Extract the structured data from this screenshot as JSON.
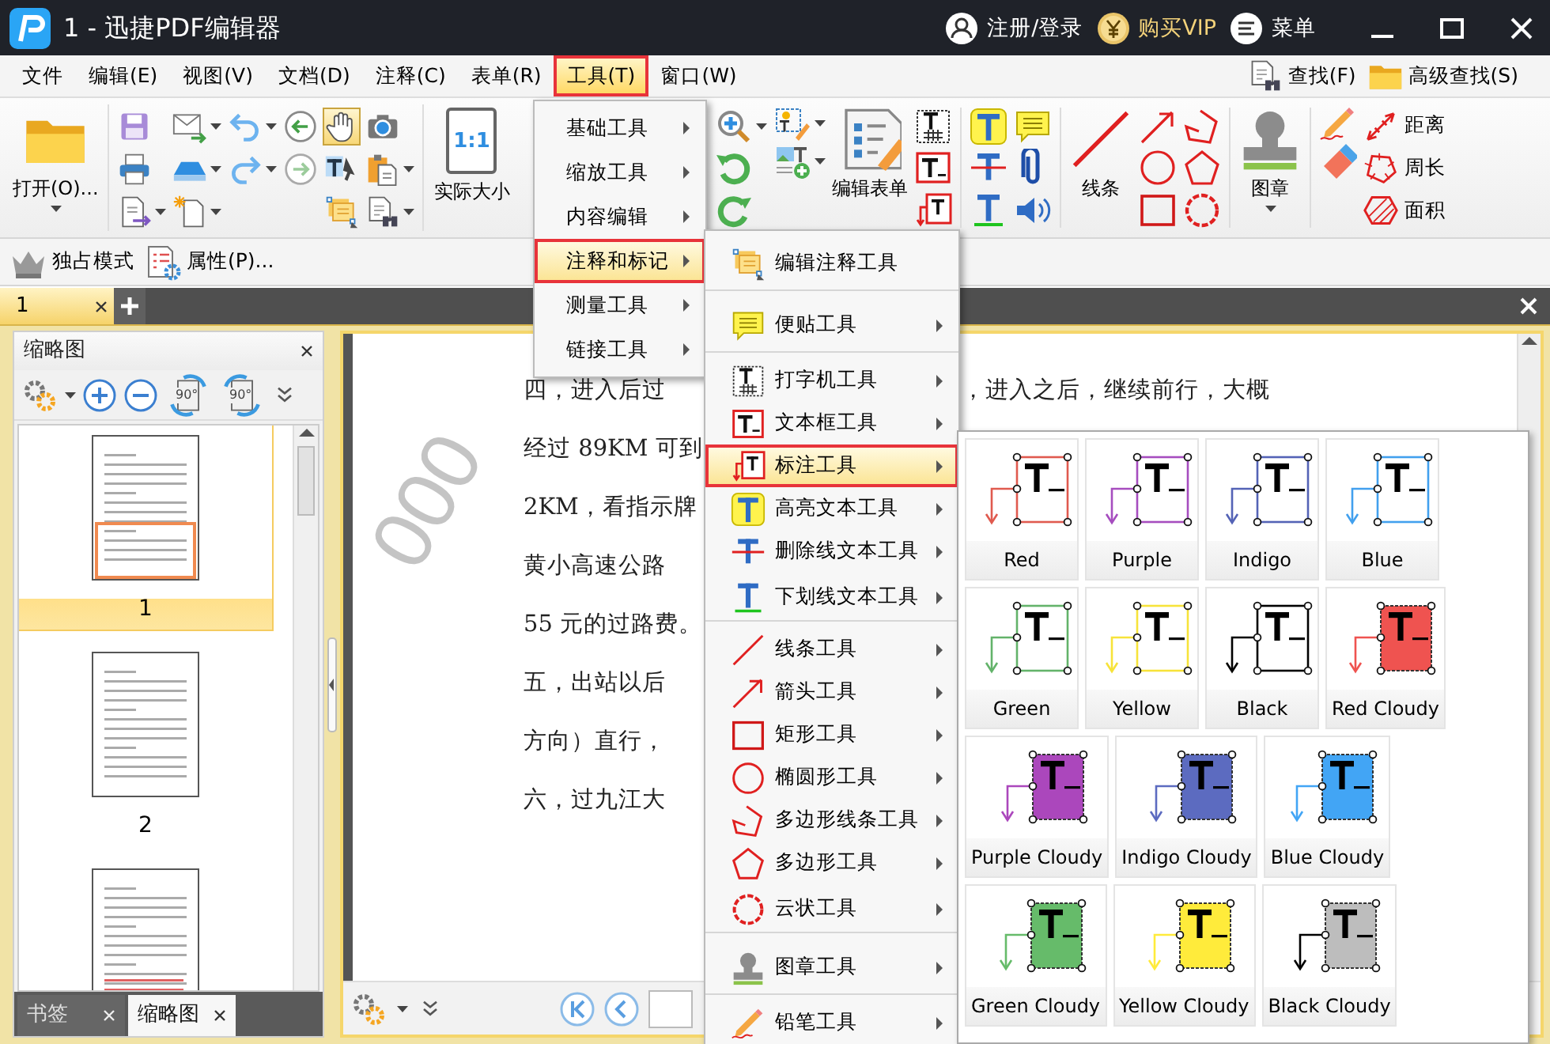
{
  "window": {
    "title": "1 - 迅捷PDF编辑器",
    "actions": [
      {
        "kind": "user",
        "label": "注册/登录"
      },
      {
        "kind": "vip",
        "label": "购买VIP"
      },
      {
        "kind": "menu",
        "label": "菜单"
      }
    ]
  },
  "menubar": {
    "items": [
      {
        "label": "文件",
        "selected": false
      },
      {
        "label": "编辑(E)",
        "selected": false
      },
      {
        "label": "视图(V)",
        "selected": false
      },
      {
        "label": "文档(D)",
        "selected": false
      },
      {
        "label": "注释(C)",
        "selected": false
      },
      {
        "label": "表单(R)",
        "selected": false
      },
      {
        "label": "工具(T)",
        "selected": true
      },
      {
        "label": "窗口(W)",
        "selected": false
      }
    ],
    "search": [
      {
        "kind": "find",
        "label": "查找(F)"
      },
      {
        "kind": "advanced",
        "label": "高级查找(S)"
      }
    ]
  },
  "toolbar": {
    "open": "打开(O)...",
    "actual_size": {
      "icon_text": "1:1",
      "label": "实际大小"
    },
    "edit_form": "编辑表单",
    "line": "线条",
    "stamp": "图章",
    "measure": [
      {
        "kind": "distance",
        "label": "距离"
      },
      {
        "kind": "perimeter",
        "label": "周长"
      },
      {
        "kind": "area",
        "label": "面积"
      }
    ]
  },
  "toolbar2": [
    {
      "kind": "exclusive",
      "label": "独占模式"
    },
    {
      "kind": "properties",
      "label": "属性(P)..."
    }
  ],
  "doc_tabs": [
    {
      "label": "1",
      "selected": true
    }
  ],
  "thumbnails": {
    "title": "缩略图",
    "rotate_labels": [
      "90°",
      "90°"
    ],
    "pages": [
      {
        "label": "1",
        "selected": true
      },
      {
        "label": "2",
        "selected": false
      },
      {
        "selected": false
      }
    ],
    "panel_tabs": [
      {
        "label": "书签",
        "selected": false
      },
      {
        "label": "缩略图",
        "selected": true
      }
    ]
  },
  "document": {
    "watermark": "000",
    "lines": [
      "四，进入后过",
      "经过 89KM 可到",
      "2KM，看指示牌",
      "黄小高速公路",
      "55 元的过路费。",
      "五，出站以后",
      "方向）直行，",
      "六，过九江大"
    ],
    "first_line_tail": "，进入之后，继续前行，大概"
  },
  "tools_menu": [
    {
      "label": "基础工具",
      "selected": false
    },
    {
      "label": "缩放工具",
      "selected": false
    },
    {
      "label": "内容编辑",
      "selected": false
    },
    {
      "label": "注释和标记",
      "selected": true
    },
    {
      "label": "测量工具",
      "selected": false
    },
    {
      "label": "链接工具",
      "selected": false
    }
  ],
  "annotation_menu": [
    {
      "kind": "edit",
      "label": "编辑注释工具",
      "submenu": false,
      "separator_after": true,
      "selected": false
    },
    {
      "kind": "note",
      "label": "便贴工具",
      "submenu": true,
      "separator_after": true,
      "selected": false
    },
    {
      "kind": "typewriter",
      "label": "打字机工具",
      "submenu": true,
      "separator_after": false,
      "selected": false
    },
    {
      "kind": "textbox",
      "label": "文本框工具",
      "submenu": true,
      "separator_after": false,
      "selected": false
    },
    {
      "kind": "callout",
      "label": "标注工具",
      "submenu": true,
      "separator_after": false,
      "selected": true
    },
    {
      "kind": "highlight",
      "label": "高亮文本工具",
      "submenu": true,
      "separator_after": false,
      "selected": false
    },
    {
      "kind": "strikeout",
      "label": "删除线文本工具",
      "submenu": true,
      "separator_after": false,
      "selected": false
    },
    {
      "kind": "underline",
      "label": "下划线文本工具",
      "submenu": true,
      "separator_after": true,
      "selected": false
    },
    {
      "kind": "line",
      "label": "线条工具",
      "submenu": true,
      "separator_after": false,
      "selected": false
    },
    {
      "kind": "arrow",
      "label": "箭头工具",
      "submenu": true,
      "separator_after": false,
      "selected": false
    },
    {
      "kind": "rect",
      "label": "矩形工具",
      "submenu": true,
      "separator_after": false,
      "selected": false
    },
    {
      "kind": "ellipse",
      "label": "椭圆形工具",
      "submenu": true,
      "separator_after": false,
      "selected": false
    },
    {
      "kind": "polyline",
      "label": "多边形线条工具",
      "submenu": true,
      "separator_after": false,
      "selected": false
    },
    {
      "kind": "polygon",
      "label": "多边形工具",
      "submenu": true,
      "separator_after": false,
      "selected": false
    },
    {
      "kind": "cloud",
      "label": "云状工具",
      "submenu": true,
      "separator_after": true,
      "selected": false
    },
    {
      "kind": "stamp",
      "label": "图章工具",
      "submenu": true,
      "separator_after": true,
      "selected": false
    },
    {
      "kind": "pencil",
      "label": "铅笔工具",
      "submenu": true,
      "separator_after": false,
      "selected": false
    }
  ],
  "callout_styles": [
    {
      "label": "Red",
      "color": "#e05a4f",
      "cloudy": false
    },
    {
      "label": "Purple",
      "color": "#a64dbf",
      "cloudy": false
    },
    {
      "label": "Indigo",
      "color": "#5463b6",
      "cloudy": false
    },
    {
      "label": "Blue",
      "color": "#42a0ee",
      "cloudy": false
    },
    {
      "label": "Green",
      "color": "#63b36a",
      "cloudy": false
    },
    {
      "label": "Yellow",
      "color": "#f7e33a",
      "cloudy": false
    },
    {
      "label": "Black",
      "color": "#000000",
      "cloudy": false
    },
    {
      "label": "Red Cloudy",
      "color": "#ef5350",
      "cloudy": true
    },
    {
      "label": "Purple Cloudy",
      "color": "#ab47bc",
      "cloudy": true
    },
    {
      "label": "Indigo Cloudy",
      "color": "#5c6bc0",
      "cloudy": true
    },
    {
      "label": "Blue Cloudy",
      "color": "#42a5f5",
      "cloudy": true
    },
    {
      "label": "Green Cloudy",
      "color": "#66bb6a",
      "cloudy": true
    },
    {
      "label": "Yellow Cloudy",
      "color": "#ffeb3b",
      "cloudy": true
    },
    {
      "label": "Black Cloudy",
      "color": "#000000",
      "cloudy": true
    }
  ]
}
